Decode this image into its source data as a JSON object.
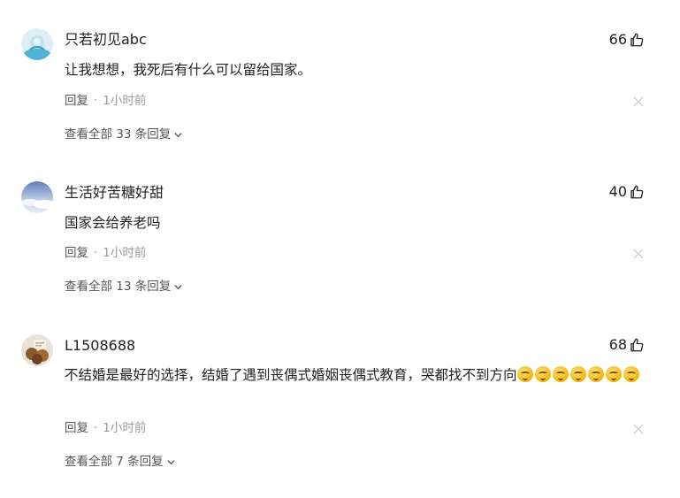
{
  "comments": [
    {
      "username": "只若初见abc",
      "likes": "66",
      "text": "让我想想，我死后有什么可以留给国家。",
      "reply_label": "回复",
      "separator": "·",
      "time": "1小时前",
      "view_replies": "查看全部 33 条回复",
      "avatar_icon": "cartoon-avatar-icon"
    },
    {
      "username": "生活好苦糖好甜",
      "likes": "40",
      "text": "国家会给养老吗",
      "reply_label": "回复",
      "separator": "·",
      "time": "1小时前",
      "view_replies": "查看全部 13 条回复",
      "avatar_icon": "sky-avatar-icon"
    },
    {
      "username": "L1508688",
      "likes": "68",
      "text": "不结婚是最好的选择，结婚了遇到丧偶式婚姻丧偶式教育，哭都找不到方向",
      "emoji_count": 7,
      "emoji_icon": "thinking-face-emoji",
      "reply_label": "回复",
      "separator": "·",
      "time": "1小时前",
      "view_replies": "查看全部 7 条回复",
      "avatar_icon": "chocolate-avatar-icon"
    }
  ],
  "colors": {
    "text": "#222222",
    "meta": "#999999",
    "reply": "#555555",
    "close": "#cccccc"
  }
}
